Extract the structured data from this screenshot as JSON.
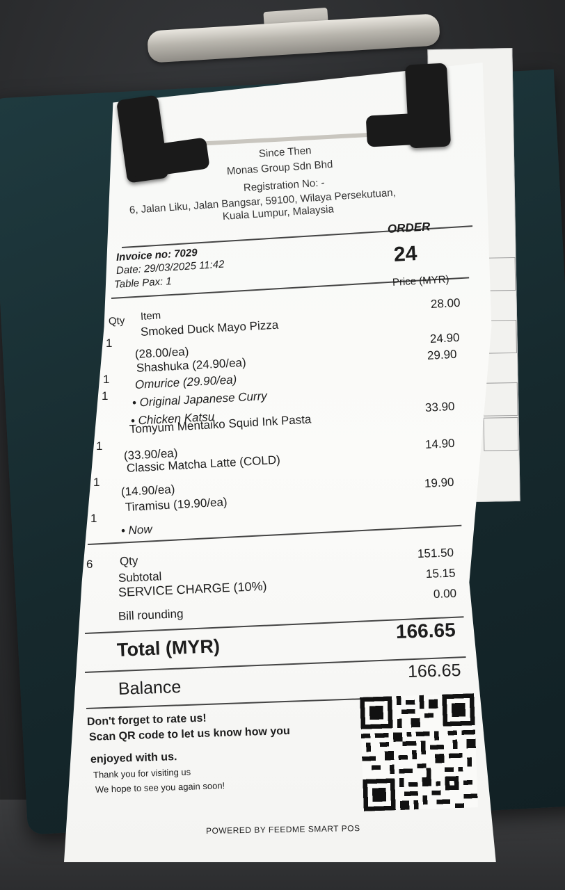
{
  "receipt": {
    "header": {
      "since": "Since Then",
      "company": "Monas Group Sdn Bhd",
      "registration": "Registration No: -",
      "address_line1": "6, Jalan Liku, Jalan Bangsar, 59100, Wilaya Persekutuan,",
      "address_line2": "Kuala Lumpur, Malaysia"
    },
    "order": {
      "label": "ORDER",
      "number": "24"
    },
    "meta": {
      "invoice": "Invoice no: 7029",
      "date": "Date: 29/03/2025 11:42",
      "pax": "Table Pax: 1"
    },
    "columns": {
      "qty": "Qty",
      "item": "Item",
      "price": "Price (MYR)"
    },
    "items": [
      {
        "qty": "1",
        "name": "Smoked Duck Mayo Pizza",
        "unit": "(28.00/ea)",
        "price": "28.00",
        "mods": []
      },
      {
        "qty": "1",
        "name": "Shashuka  (24.90/ea)",
        "unit": "",
        "price": "24.90",
        "mods": []
      },
      {
        "qty": "1",
        "name": "Omurice  (29.90/ea)",
        "unit": "",
        "price": "29.90",
        "mods": [
          "• Original Japanese Curry",
          "• Chicken Katsu"
        ]
      },
      {
        "qty": "1",
        "name": "Tomyum Mentaiko Squid Ink Pasta",
        "unit": "(33.90/ea)",
        "price": "33.90",
        "mods": []
      },
      {
        "qty": "1",
        "name": "Classic Matcha Latte (COLD)",
        "unit": "(14.90/ea)",
        "price": "14.90",
        "mods": []
      },
      {
        "qty": "1",
        "name": "Tiramisu  (19.90/ea)",
        "unit": "",
        "price": "19.90",
        "mods": [
          "• Now"
        ]
      }
    ],
    "summary": {
      "total_qty": "6",
      "qty_label": "Qty",
      "subtotal_label": "Subtotal",
      "subtotal_value": "151.50",
      "service_label": "SERVICE CHARGE (10%)",
      "service_value": "15.15",
      "rounding_label": "Bill rounding",
      "rounding_value": "0.00"
    },
    "total": {
      "label": "Total (MYR)",
      "value": "166.65"
    },
    "balance": {
      "label": "Balance",
      "value": "166.65"
    },
    "footer": {
      "rate_line1": "Don't forget to rate us!",
      "rate_line2": "Scan QR code to let us know how you",
      "rate_line3": "enjoyed with us.",
      "thanks": "Thank you for visiting us",
      "hope": "We hope to see you again soon!",
      "powered": "POWERED BY FEEDME SMART POS"
    },
    "qr_icon": "qr-code-icon"
  }
}
